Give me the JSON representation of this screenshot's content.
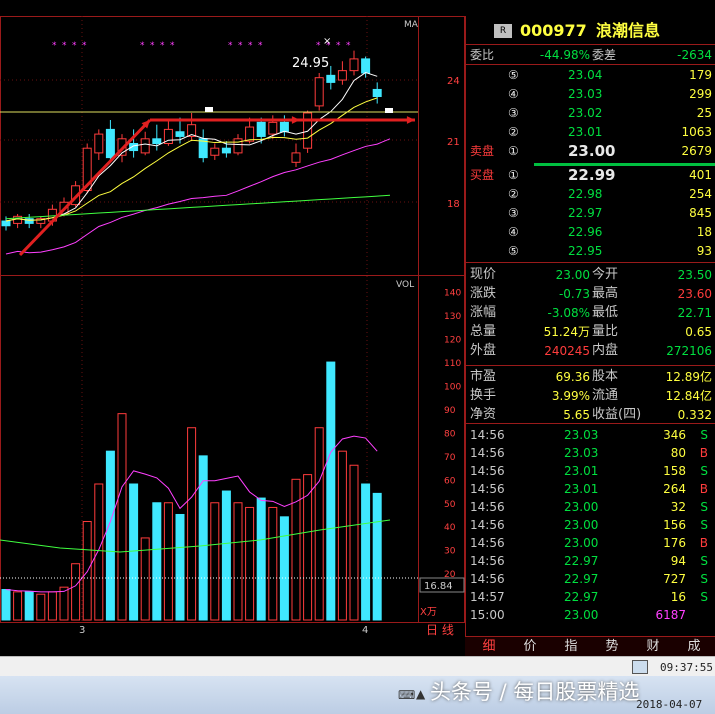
{
  "stock": {
    "badge": "R",
    "code": "000977",
    "name": "浪潮信息"
  },
  "weibi": {
    "label1": "委比",
    "value1": "-44.98%",
    "label2": "委差",
    "value2": "-2634"
  },
  "sell_label": "卖盘",
  "buy_label": "买盘",
  "sell_orders": [
    {
      "level": "⑤",
      "price": "23.04",
      "vol": "179"
    },
    {
      "level": "④",
      "price": "23.03",
      "vol": "299"
    },
    {
      "level": "③",
      "price": "23.02",
      "vol": "25"
    },
    {
      "level": "②",
      "price": "23.01",
      "vol": "1063"
    },
    {
      "level": "①",
      "price": "23.00",
      "vol": "2679"
    }
  ],
  "buy_orders": [
    {
      "level": "①",
      "price": "22.99",
      "vol": "401"
    },
    {
      "level": "②",
      "price": "22.98",
      "vol": "254"
    },
    {
      "level": "③",
      "price": "22.97",
      "vol": "845"
    },
    {
      "level": "④",
      "price": "22.96",
      "vol": "18"
    },
    {
      "level": "⑤",
      "price": "22.95",
      "vol": "93"
    }
  ],
  "quote_rows": [
    {
      "l1": "现价",
      "v1": "23.00",
      "l2": "今开",
      "v2": "23.50"
    },
    {
      "l1": "涨跌",
      "v1": "-0.73",
      "l2": "最高",
      "v2": "23.60"
    },
    {
      "l1": "涨幅",
      "v1": "-3.08%",
      "l2": "最低",
      "v2": "22.71"
    },
    {
      "l1": "总量",
      "v1": "51.24万",
      "l2": "量比",
      "v2": "0.65"
    },
    {
      "l1": "外盘",
      "v1": "240245",
      "l2": "内盘",
      "v2": "272106"
    }
  ],
  "fund_rows": [
    {
      "l1": "市盈",
      "v1": "69.36",
      "l2": "股本",
      "v2": "12.89亿"
    },
    {
      "l1": "换手",
      "v1": "3.99%",
      "l2": "流通",
      "v2": "12.84亿"
    },
    {
      "l1": "净资",
      "v1": "5.65",
      "l2": "收益(四)",
      "v2": "0.332"
    }
  ],
  "ticks": [
    {
      "time": "14:56",
      "price": "23.03",
      "vol": "346",
      "side": "S"
    },
    {
      "time": "14:56",
      "price": "23.03",
      "vol": "80",
      "side": "B"
    },
    {
      "time": "14:56",
      "price": "23.01",
      "vol": "158",
      "side": "S"
    },
    {
      "time": "14:56",
      "price": "23.01",
      "vol": "264",
      "side": "B"
    },
    {
      "time": "14:56",
      "price": "23.00",
      "vol": "32",
      "side": "S"
    },
    {
      "time": "14:56",
      "price": "23.00",
      "vol": "156",
      "side": "S"
    },
    {
      "time": "14:56",
      "price": "23.00",
      "vol": "176",
      "side": "B"
    },
    {
      "time": "14:56",
      "price": "22.97",
      "vol": "94",
      "side": "S"
    },
    {
      "time": "14:56",
      "price": "22.97",
      "vol": "727",
      "side": "S"
    },
    {
      "time": "14:57",
      "price": "22.97",
      "vol": "16",
      "side": "S"
    },
    {
      "time": "15:00",
      "price": "23.00",
      "vol": "6187",
      "side": ""
    }
  ],
  "tabs": [
    "细",
    "价",
    "指",
    "势",
    "财",
    "成"
  ],
  "chart": {
    "ma_label": "MA",
    "vol_label": "VOL",
    "high_label": "24.95",
    "price_ticks": [
      "24",
      "21",
      "18"
    ],
    "vol_ticks": [
      "140",
      "130",
      "120",
      "110",
      "100",
      "90",
      "80",
      "70",
      "60",
      "50",
      "40",
      "30",
      "20"
    ],
    "vol_current": "16.84",
    "vol_unit": "X万",
    "date_labels": [
      "3",
      "4"
    ],
    "period_label": "日 线"
  },
  "chart_data": {
    "type": "candlestick",
    "candles": [
      {
        "o": 17.5,
        "c": 17.7,
        "h": 17.9,
        "l": 17.3,
        "up": false
      },
      {
        "o": 17.6,
        "c": 17.9,
        "h": 18.0,
        "l": 17.4,
        "up": true
      },
      {
        "o": 17.8,
        "c": 17.6,
        "h": 18.0,
        "l": 17.4,
        "up": false
      },
      {
        "o": 17.6,
        "c": 17.8,
        "h": 17.9,
        "l": 17.4,
        "up": true
      },
      {
        "o": 17.7,
        "c": 18.2,
        "h": 18.4,
        "l": 17.5,
        "up": true
      },
      {
        "o": 18.0,
        "c": 18.5,
        "h": 18.7,
        "l": 17.9,
        "up": true
      },
      {
        "o": 18.4,
        "c": 19.2,
        "h": 19.4,
        "l": 18.3,
        "up": true
      },
      {
        "o": 19.0,
        "c": 20.8,
        "h": 21.0,
        "l": 18.9,
        "up": true
      },
      {
        "o": 20.6,
        "c": 21.4,
        "h": 21.6,
        "l": 20.3,
        "up": true
      },
      {
        "o": 21.6,
        "c": 20.4,
        "h": 22.0,
        "l": 20.2,
        "up": false
      },
      {
        "o": 20.5,
        "c": 21.2,
        "h": 21.4,
        "l": 20.2,
        "up": true
      },
      {
        "o": 21.0,
        "c": 20.7,
        "h": 21.6,
        "l": 20.4,
        "up": false
      },
      {
        "o": 20.6,
        "c": 21.2,
        "h": 21.5,
        "l": 20.5,
        "up": true
      },
      {
        "o": 21.2,
        "c": 21.0,
        "h": 21.8,
        "l": 20.7,
        "up": false
      },
      {
        "o": 21.0,
        "c": 21.6,
        "h": 22.0,
        "l": 20.9,
        "up": true
      },
      {
        "o": 21.5,
        "c": 21.3,
        "h": 22.1,
        "l": 21.0,
        "up": false
      },
      {
        "o": 21.3,
        "c": 21.8,
        "h": 22.3,
        "l": 21.1,
        "up": true
      },
      {
        "o": 21.2,
        "c": 20.4,
        "h": 21.6,
        "l": 20.2,
        "up": false
      },
      {
        "o": 20.5,
        "c": 20.8,
        "h": 21.0,
        "l": 20.3,
        "up": true
      },
      {
        "o": 20.8,
        "c": 20.6,
        "h": 21.1,
        "l": 20.4,
        "up": false
      },
      {
        "o": 20.6,
        "c": 21.2,
        "h": 21.4,
        "l": 20.5,
        "up": true
      },
      {
        "o": 21.1,
        "c": 21.7,
        "h": 22.1,
        "l": 21.0,
        "up": true
      },
      {
        "o": 21.9,
        "c": 21.3,
        "h": 22.1,
        "l": 21.0,
        "up": false
      },
      {
        "o": 21.4,
        "c": 21.9,
        "h": 22.2,
        "l": 21.2,
        "up": true
      },
      {
        "o": 21.9,
        "c": 21.5,
        "h": 22.2,
        "l": 21.3,
        "up": false
      },
      {
        "o": 20.2,
        "c": 20.6,
        "h": 21.0,
        "l": 20.0,
        "up": true
      },
      {
        "o": 20.8,
        "c": 22.3,
        "h": 22.4,
        "l": 20.6,
        "up": true
      },
      {
        "o": 22.6,
        "c": 23.8,
        "h": 24.0,
        "l": 22.4,
        "up": true
      },
      {
        "o": 23.9,
        "c": 23.6,
        "h": 24.3,
        "l": 23.3,
        "up": false
      },
      {
        "o": 23.7,
        "c": 24.1,
        "h": 24.5,
        "l": 23.5,
        "up": true
      },
      {
        "o": 24.1,
        "c": 24.6,
        "h": 24.95,
        "l": 23.9,
        "up": true
      },
      {
        "o": 24.6,
        "c": 24.0,
        "h": 24.7,
        "l": 23.8,
        "up": false
      },
      {
        "o": 23.3,
        "c": 23.0,
        "h": 23.6,
        "l": 22.7,
        "up": false
      }
    ],
    "volumes": [
      13,
      12,
      12,
      11,
      12,
      14,
      24,
      42,
      58,
      72,
      88,
      58,
      35,
      50,
      50,
      45,
      82,
      70,
      50,
      55,
      50,
      48,
      52,
      48,
      44,
      60,
      62,
      82,
      110,
      72,
      66,
      58,
      54
    ],
    "vol_yrange": [
      0,
      145
    ],
    "price_yrange": [
      16,
      26
    ]
  }
}
